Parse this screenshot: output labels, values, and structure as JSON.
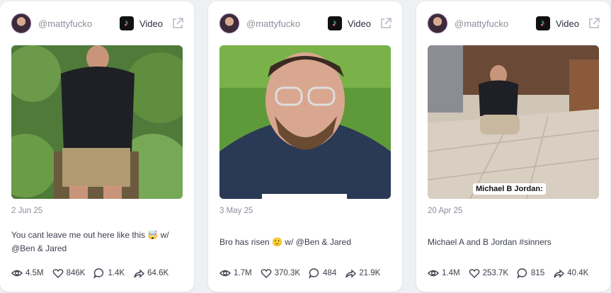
{
  "cards": [
    {
      "handle": "@mattyfucko",
      "type_label": "Video",
      "date": "2 Jun 25",
      "caption": "You cant leave me out here like this 🤯 w/ @Ben & Jared",
      "views": "4.5M",
      "likes": "846K",
      "comments": "1.4K",
      "shares": "64.6K",
      "subtitle": ""
    },
    {
      "handle": "@mattyfucko",
      "type_label": "Video",
      "date": "3 May 25",
      "caption": "Bro has risen 🙂 w/ @Ben & Jared",
      "views": "1.7M",
      "likes": "370.3K",
      "comments": "484",
      "shares": "21.9K",
      "subtitle": ""
    },
    {
      "handle": "@mattyfucko",
      "type_label": "Video",
      "date": "20 Apr 25",
      "caption": "Michael A and B Jordan #sinners",
      "views": "1.4M",
      "likes": "253.7K",
      "comments": "815",
      "shares": "40.4K",
      "subtitle": "Michael B Jordan:"
    }
  ],
  "icons": {
    "platform": "tiktok-icon",
    "external": "external-link-icon",
    "views": "eye-icon",
    "likes": "heart-icon",
    "comments": "comment-icon",
    "shares": "share-icon"
  },
  "colors": {
    "accent": "#2b2f3a",
    "muted": "#8a8f9c",
    "card_bg": "#ffffff"
  }
}
